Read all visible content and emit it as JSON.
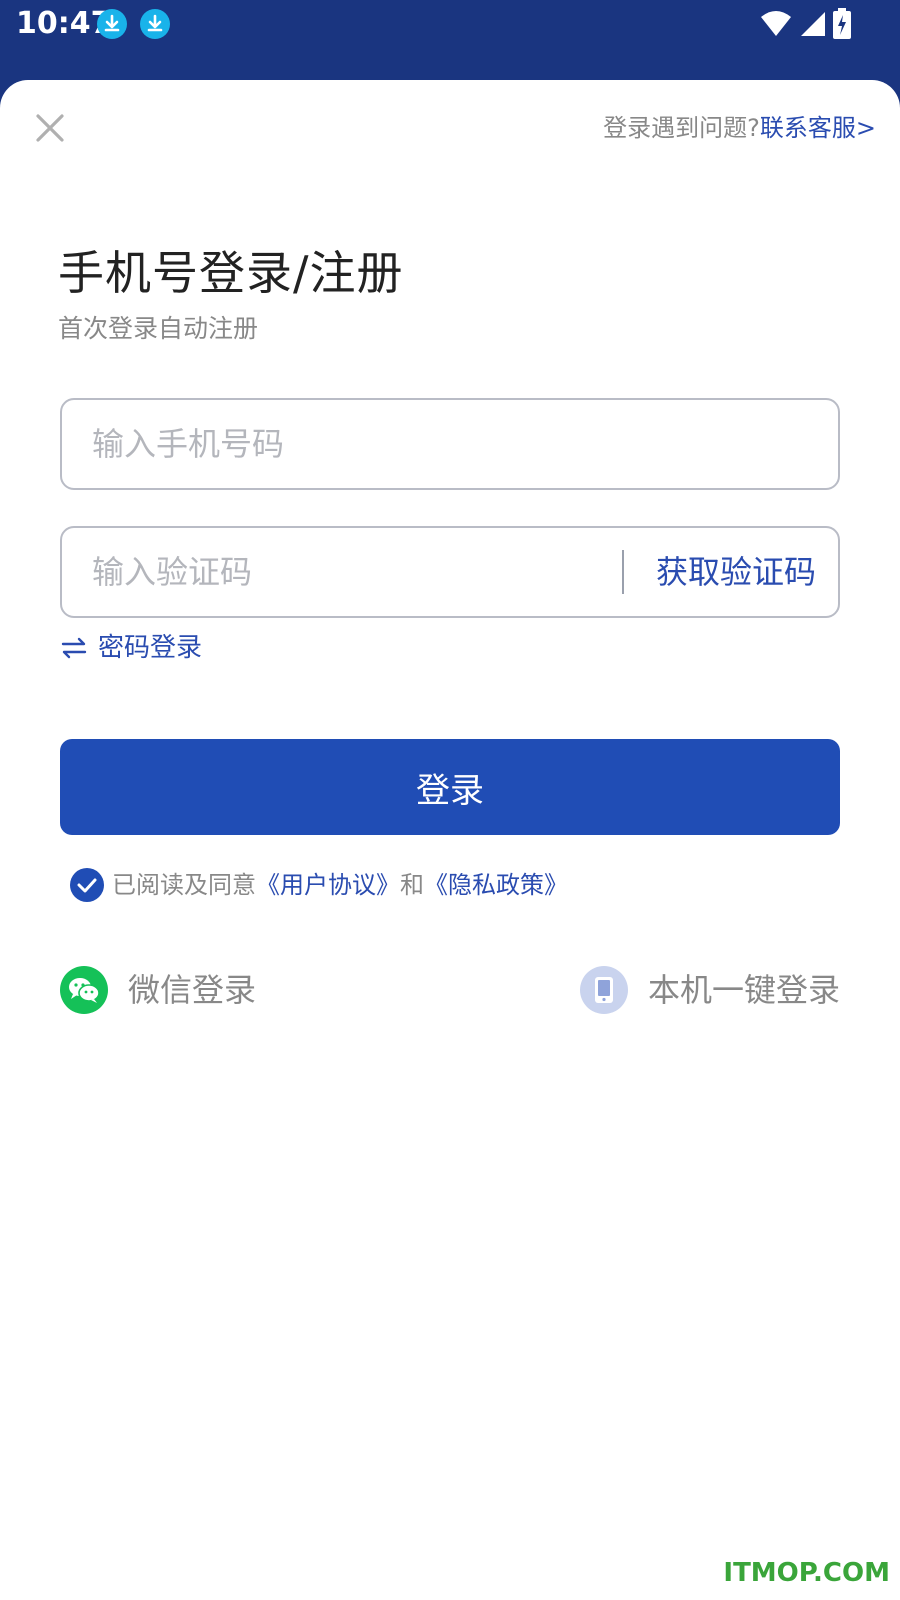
{
  "status_bar": {
    "time": "10:47",
    "icons": [
      "download-icon",
      "download-icon",
      "wifi-icon",
      "signal-icon",
      "battery-charging-icon"
    ]
  },
  "header": {
    "close_icon": "close-icon",
    "help_text": "登录遇到问题?",
    "contact_link": "联系客服>"
  },
  "main": {
    "title": "手机号登录/注册",
    "subtitle": "首次登录自动注册",
    "phone_placeholder": "输入手机号码",
    "code_placeholder": "输入验证码",
    "get_code_label": "获取验证码",
    "password_login_label": "密码登录",
    "login_button_label": "登录"
  },
  "agreement": {
    "checked": true,
    "prefix": "已阅读及同意",
    "user_agreement": "《用户协议》",
    "and": "和",
    "privacy_policy": "《隐私政策》"
  },
  "alt_login": {
    "wechat_label": "微信登录",
    "onekey_label": "本机一键登录"
  },
  "colors": {
    "accent": "#204db5",
    "link": "#2a4cb0",
    "status_bar": "#1a3580",
    "wechat": "#15c158"
  },
  "watermark": "ITMOP.COM"
}
